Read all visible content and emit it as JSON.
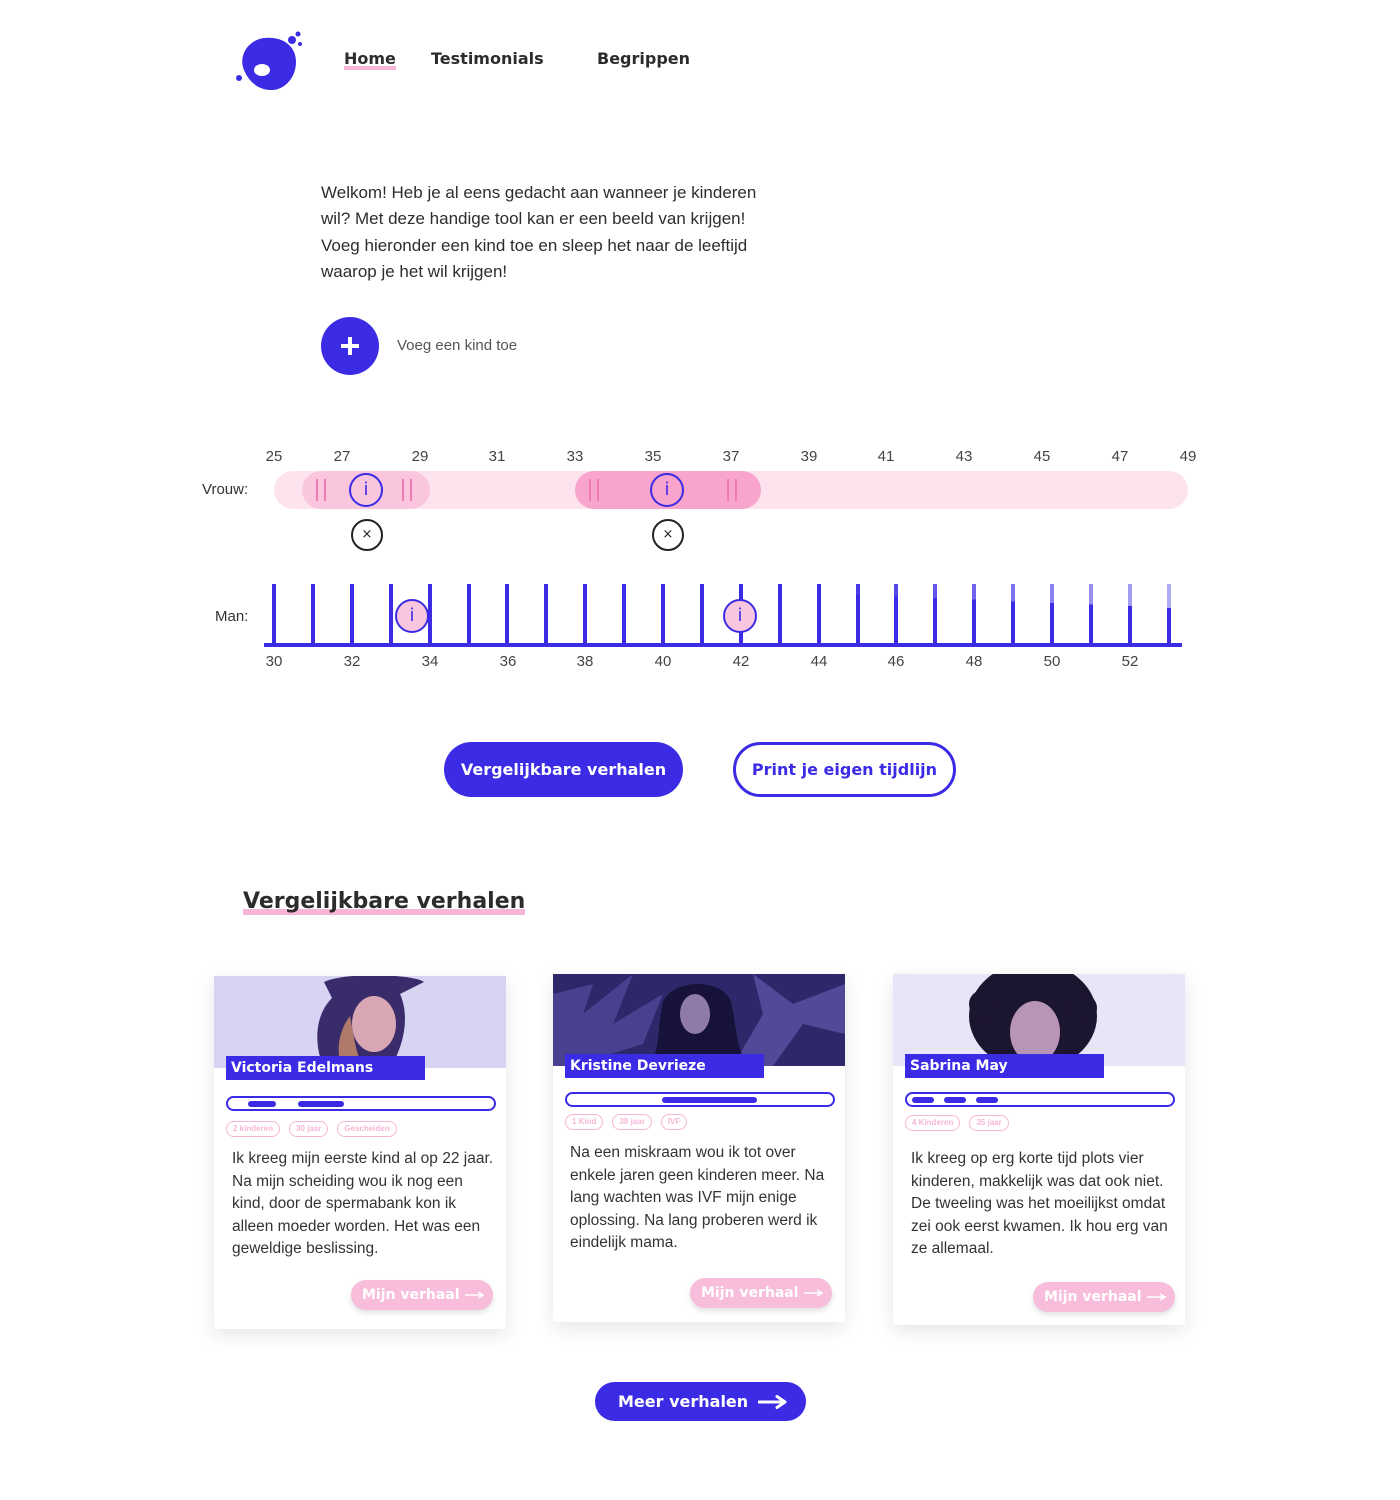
{
  "brand": {
    "logo_icon": "blob-logo-icon",
    "accent": "#3b2be5",
    "pink": "#f7b6d6"
  },
  "nav": {
    "items": [
      {
        "label": "Home",
        "active": true
      },
      {
        "label": "Testimonials"
      },
      {
        "label": "Begrippen"
      }
    ]
  },
  "intro": {
    "line1": "Welkom! Heb je al eens gedacht aan wanneer je kinderen",
    "line2": "wil? Met deze handige tool kan er een beeld van krijgen!",
    "line3": "Voeg hieronder een kind toe en sleep het naar de leeftijd",
    "line4": "waarop je het wil krijgen!"
  },
  "add_child": {
    "icon": "plus-icon",
    "label": "Voeg een kind toe"
  },
  "timeline": {
    "woman": {
      "label": "Vrouw:",
      "ticks": [
        "25",
        "27",
        "29",
        "31",
        "33",
        "35",
        "37",
        "39",
        "41",
        "43",
        "45",
        "47",
        "49"
      ],
      "info_glyph": "i",
      "remove_glyph": "×"
    },
    "man": {
      "label": "Man:",
      "ticks": [
        "30",
        "32",
        "34",
        "36",
        "38",
        "40",
        "42",
        "44",
        "46",
        "48",
        "50",
        "52"
      ],
      "info_glyph": "i"
    }
  },
  "actions": {
    "similar_label": "Vergelijkbare verhalen",
    "print_label": "Print je eigen tijdlijn"
  },
  "stories": {
    "title": "Vergelijkbare verhalen",
    "cards": [
      {
        "name": "Victoria Edelmans",
        "tags": [
          "2 kinderen",
          "30 jaar",
          "Gescheiden"
        ],
        "text": "Ik kreeg mijn eerste kind al op 22 jaar. Na mijn scheiding wou ik nog een kind, door de spermabank kon ik alleen moeder worden. Het was een geweldige beslissing.",
        "button": "Mijn verhaal"
      },
      {
        "name": "Kristine Devrieze",
        "tags": [
          "1 Kind",
          "38 jaar",
          "IVF"
        ],
        "text": "Na een miskraam wou ik tot over enkele jaren geen kinderen meer. Na lang wachten was IVF mijn enige oplossing. Na lang proberen werd ik eindelijk mama.",
        "button": "Mijn verhaal"
      },
      {
        "name": "Sabrina May",
        "tags": [
          "4 Kinderen",
          "35 jaar"
        ],
        "text": "Ik kreeg op erg korte tijd plots vier kinderen, makkelijk was dat ook niet. De tweeling was het moeilijkst omdat zei ook eerst kwamen. Ik hou erg van ze allemaal.",
        "button": "Mijn verhaal"
      }
    ],
    "more_label": "Meer verhalen",
    "more_icon": "arrow-right-icon"
  }
}
